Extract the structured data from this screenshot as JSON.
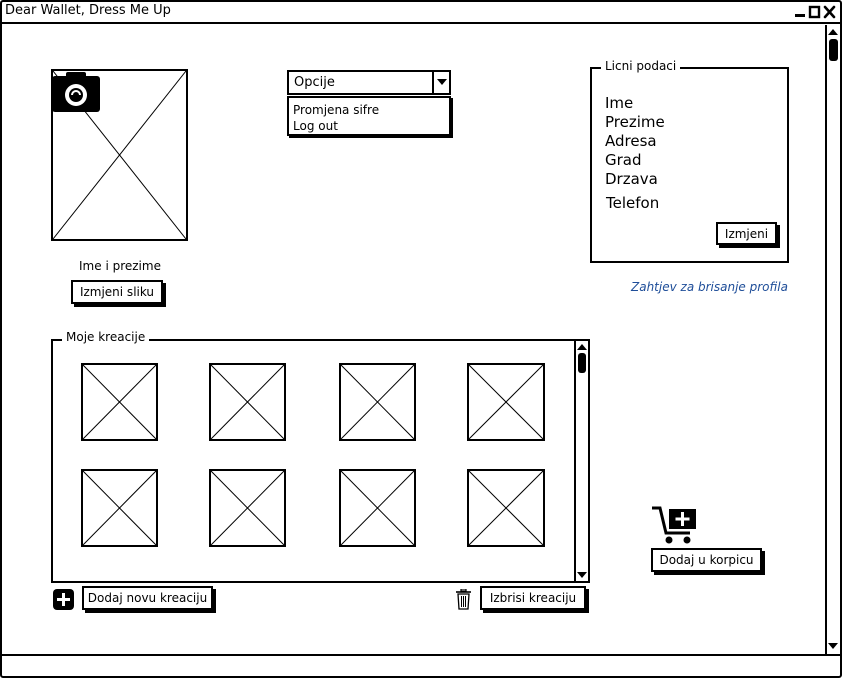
{
  "window": {
    "title": "Dear Wallet, Dress Me Up"
  },
  "profile": {
    "name_label": "Ime i prezime",
    "change_photo_button": "Izmjeni sliku"
  },
  "options": {
    "selected": "Opcije",
    "items": [
      "Promjena sifre",
      "Log out"
    ]
  },
  "personal": {
    "legend": "Licni podaci",
    "fields": [
      "Ime",
      "Prezime",
      "Adresa",
      "Grad",
      "Drzava",
      "Telefon"
    ],
    "edit_button": "Izmjeni"
  },
  "delete_profile_link": "Zahtjev za brisanje profila",
  "creations": {
    "legend": "Moje kreacije",
    "add_button": "Dodaj novu kreaciju",
    "delete_button": "Izbrisi kreaciju"
  },
  "cart": {
    "add_button": "Dodaj u korpicu"
  },
  "icons": {
    "camera": "camera-icon",
    "plus": "plus-icon",
    "trash": "trash-icon",
    "cart": "cart-icon",
    "link_color": "#1f4e99"
  }
}
